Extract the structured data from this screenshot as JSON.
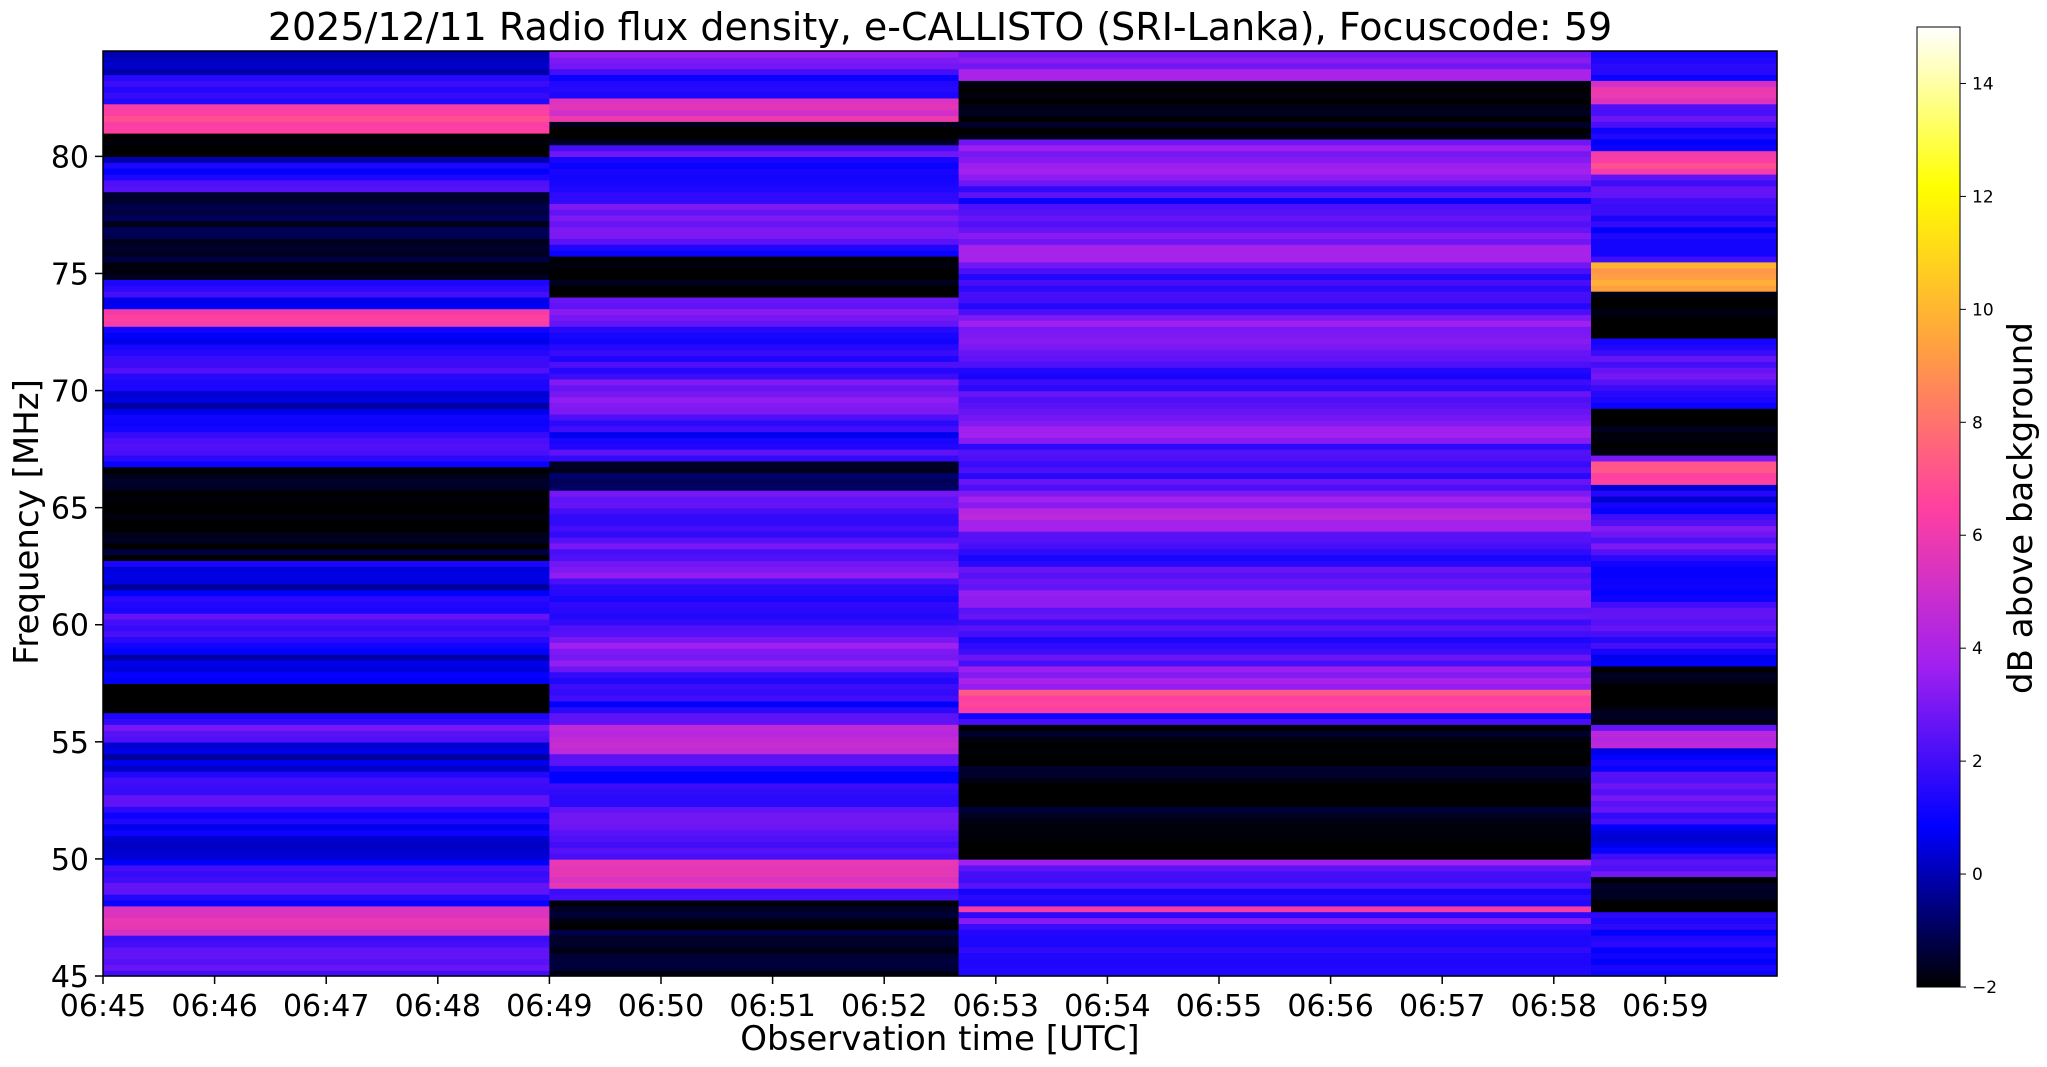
{
  "chart_data": {
    "type": "heatmap",
    "title": "2025/12/11  Radio flux density, e-CALLISTO (SRI-Lanka), Focuscode: 59",
    "xlabel": "Observation time [UTC]",
    "ylabel": "Frequency [MHz]",
    "ylim": [
      45,
      84.5
    ],
    "x_tick_labels": [
      "06:45",
      "06:46",
      "06:47",
      "06:48",
      "06:49",
      "06:50",
      "06:51",
      "06:52",
      "06:53",
      "06:54",
      "06:55",
      "06:56",
      "06:57",
      "06:58",
      "06:59"
    ],
    "x_range": [
      "06:45",
      "06:60"
    ],
    "y_ticks": [
      45,
      50,
      55,
      60,
      65,
      70,
      75,
      80
    ],
    "y_tick_labels": [
      "45",
      "50",
      "55",
      "60",
      "65",
      "70",
      "75",
      "80"
    ],
    "colorbar": {
      "label": "dB above background",
      "range": [
        -2,
        15
      ],
      "ticks": [
        -2,
        0,
        2,
        4,
        6,
        8,
        10,
        12,
        14
      ],
      "tick_labels": [
        "−2",
        "0",
        "2",
        "4",
        "6",
        "8",
        "10",
        "12",
        "14"
      ],
      "colormap": "gnuplot2",
      "color_stops": [
        "#000000",
        "#0000ff",
        "#a020f0",
        "#ff40a0",
        "#ffa040",
        "#ffff00",
        "#ffffff"
      ]
    },
    "segments": [
      {
        "start": "06:45",
        "end": "06:49",
        "base_db": 1.2,
        "bands": [
          {
            "f_from": 81,
            "f_to": 82.3,
            "db": 6.5
          },
          {
            "f_from": 72.7,
            "f_to": 73.6,
            "db": 6.2
          },
          {
            "f_from": 80,
            "f_to": 81,
            "db": -2
          },
          {
            "f_from": 74.8,
            "f_to": 78.5,
            "db": -1.5
          },
          {
            "f_from": 62.8,
            "f_to": 66.8,
            "db": -1.8
          },
          {
            "f_from": 56.3,
            "f_to": 57.5,
            "db": -2
          },
          {
            "f_from": 54.9,
            "f_to": 55.8,
            "db": 2.5
          },
          {
            "f_from": 46.8,
            "f_to": 48,
            "db": 5.5
          },
          {
            "f_from": 45,
            "f_to": 46.8,
            "db": 2.2
          }
        ]
      },
      {
        "start": "06:49",
        "end": "06:52:40",
        "base_db": 2.2,
        "bands": [
          {
            "f_from": 81.5,
            "f_to": 82.6,
            "db": 5.5
          },
          {
            "f_from": 80.6,
            "f_to": 81.5,
            "db": -2
          },
          {
            "f_from": 74,
            "f_to": 75.7,
            "db": -2
          },
          {
            "f_from": 65.8,
            "f_to": 67,
            "db": -1.2
          },
          {
            "f_from": 54.5,
            "f_to": 55.8,
            "db": 4.5
          },
          {
            "f_from": 48.8,
            "f_to": 50,
            "db": 5.5
          },
          {
            "f_from": 45,
            "f_to": 48.3,
            "db": -1.6
          }
        ]
      },
      {
        "start": "06:52:40",
        "end": "06:58:20",
        "base_db": 2.5,
        "bands": [
          {
            "f_from": 80.8,
            "f_to": 83.2,
            "db": -2
          },
          {
            "f_from": 64,
            "f_to": 65,
            "db": 4.2
          },
          {
            "f_from": 56.2,
            "f_to": 57.3,
            "db": 6.8
          },
          {
            "f_from": 50,
            "f_to": 55.7,
            "db": -1.8
          },
          {
            "f_from": 47.7,
            "f_to": 48.1,
            "db": 6
          },
          {
            "f_from": 45,
            "f_to": 47.2,
            "db": 1.4
          }
        ]
      },
      {
        "start": "06:58:20",
        "end": "06:60",
        "base_db": 1.8,
        "bands": [
          {
            "f_from": 82.3,
            "f_to": 83.2,
            "db": 5.5
          },
          {
            "f_from": 79.2,
            "f_to": 80.3,
            "db": 6.5
          },
          {
            "f_from": 74.3,
            "f_to": 75.6,
            "db": 9.5
          },
          {
            "f_from": 72.3,
            "f_to": 74.2,
            "db": -2
          },
          {
            "f_from": 66.1,
            "f_to": 66.9,
            "db": 7
          },
          {
            "f_from": 67.3,
            "f_to": 69.2,
            "db": -2
          },
          {
            "f_from": 55.7,
            "f_to": 58.3,
            "db": -2
          },
          {
            "f_from": 54.8,
            "f_to": 55.6,
            "db": 4
          },
          {
            "f_from": 47.8,
            "f_to": 49.3,
            "db": -2
          },
          {
            "f_from": 45,
            "f_to": 47.3,
            "db": 1.2
          }
        ]
      }
    ]
  }
}
